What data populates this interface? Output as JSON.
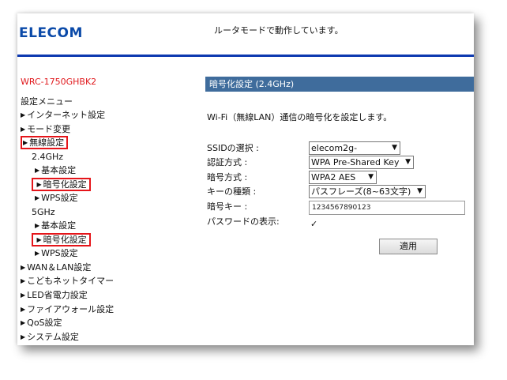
{
  "header": {
    "logo": "ELECOM",
    "mode_text": "ルータモードで動作しています。"
  },
  "sidebar": {
    "model": "WRC-1750GHBK2",
    "menu_title": "設定メニュー",
    "items": [
      {
        "label": "インターネット設定",
        "marker": "▶"
      },
      {
        "label": "モード変更",
        "marker": "▶"
      },
      {
        "label": "無線設定",
        "marker": "▶",
        "highlighted": true
      },
      {
        "label": "2.4GHz",
        "marker": ""
      },
      {
        "label": "基本設定",
        "marker": "▶"
      },
      {
        "label": "暗号化設定",
        "marker": "▶",
        "highlighted": true
      },
      {
        "label": "WPS設定",
        "marker": "▶"
      },
      {
        "label": "5GHz",
        "marker": ""
      },
      {
        "label": "基本設定",
        "marker": "▶"
      },
      {
        "label": "暗号化設定",
        "marker": "▶",
        "highlighted": true
      },
      {
        "label": "WPS設定",
        "marker": "▶"
      },
      {
        "label": "WAN＆LAN設定",
        "marker": "▶"
      },
      {
        "label": "こどもネットタイマー",
        "marker": "▶"
      },
      {
        "label": "LED省電力設定",
        "marker": "▶"
      },
      {
        "label": "ファイアウォール設定",
        "marker": "▶"
      },
      {
        "label": "QoS設定",
        "marker": "▶"
      },
      {
        "label": "システム設定",
        "marker": "▶"
      }
    ]
  },
  "main": {
    "section_title": "暗号化設定 (2.4GHz)",
    "description": "Wi-Fi（無線LAN）通信の暗号化を設定します。",
    "fields": {
      "ssid": {
        "label": "SSIDの選択 :",
        "value": "elecom2g-"
      },
      "auth": {
        "label": "認証方式 :",
        "value": "WPA Pre-Shared Key"
      },
      "cipher": {
        "label": "暗号方式 :",
        "value": "WPA2 AES"
      },
      "key_type": {
        "label": "キーの種類 :",
        "value": "パスフレーズ(8~63文字)"
      },
      "key": {
        "label": "暗号キー :",
        "value": "1234567890123"
      },
      "show_password": {
        "label": "パスワードの表示:",
        "checked": true,
        "check_glyph": "✓"
      }
    },
    "apply_label": "適用"
  },
  "colors": {
    "brand": "#0a49a8",
    "top_rule": "#0d39b0",
    "model": "#e0191d",
    "highlight_border": "#e5151a",
    "section_bar": "#3f6c9c"
  }
}
